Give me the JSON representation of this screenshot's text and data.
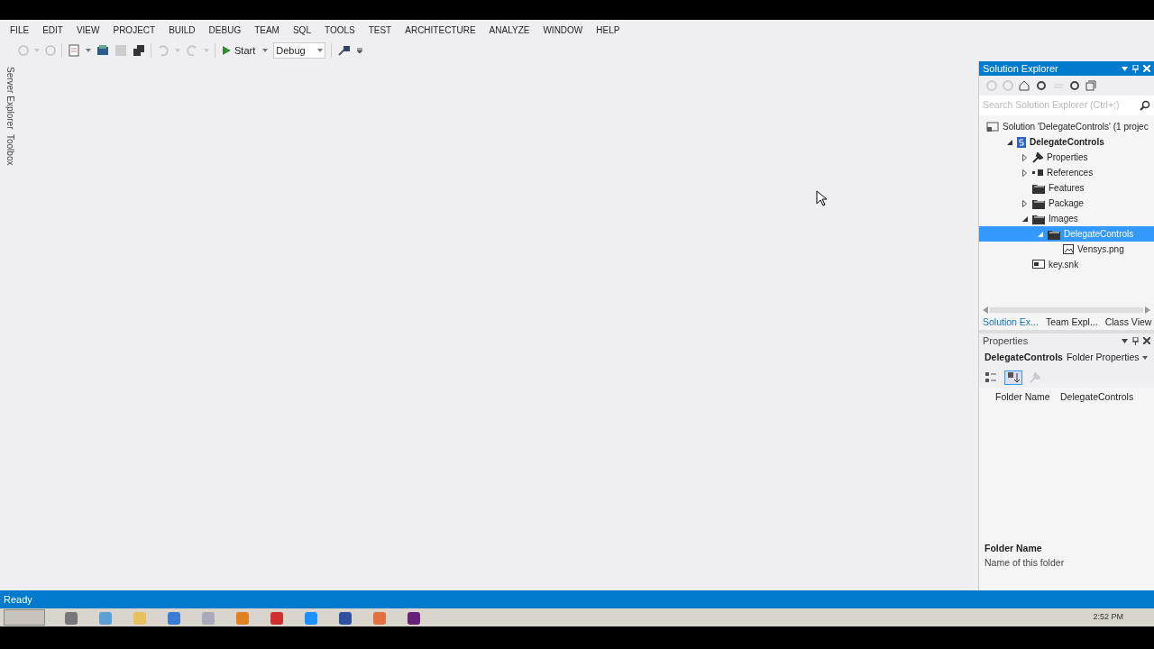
{
  "menu": [
    "FILE",
    "EDIT",
    "VIEW",
    "PROJECT",
    "BUILD",
    "DEBUG",
    "TEAM",
    "SQL",
    "TOOLS",
    "TEST",
    "ARCHITECTURE",
    "ANALYZE",
    "WINDOW",
    "HELP"
  ],
  "toolbar": {
    "start": "Start",
    "configuration": "Debug"
  },
  "side_tabs": [
    "Server Explorer",
    "Toolbox"
  ],
  "solution_explorer": {
    "title": "Solution Explorer",
    "search": {
      "placeholder": "Search Solution Explorer (Ctrl+;)"
    },
    "tree": [
      {
        "label": "Solution 'DelegateControls' (1 projec",
        "kind": "solution",
        "selected": false,
        "children": [
          {
            "label": "DelegateControls",
            "kind": "project",
            "expanded": true,
            "selected": false,
            "children": [
              {
                "label": "Properties",
                "kind": "wrench",
                "expanded": false,
                "selected": false
              },
              {
                "label": "References",
                "kind": "references",
                "expanded": false,
                "selected": false
              },
              {
                "label": "Features",
                "kind": "folder",
                "selected": false
              },
              {
                "label": "Package",
                "kind": "folder",
                "expanded": false,
                "selected": false
              },
              {
                "label": "Images",
                "kind": "folder",
                "expanded": true,
                "selected": false,
                "children": [
                  {
                    "label": "DelegateControls",
                    "kind": "folder",
                    "expanded": true,
                    "selected": true,
                    "children": [
                      {
                        "label": "Vensys.png",
                        "kind": "image",
                        "selected": false
                      }
                    ]
                  }
                ]
              },
              {
                "label": "key.snk",
                "kind": "key",
                "selected": false
              }
            ]
          }
        ]
      }
    ],
    "tabs": [
      {
        "label": "Solution Ex...",
        "selected": true
      },
      {
        "label": "Team Expl...",
        "selected": false
      },
      {
        "label": "Class View",
        "selected": false
      }
    ]
  },
  "properties": {
    "title": "Properties",
    "object_name": "DelegateControls",
    "object_type": "Folder Properties",
    "rows": [
      {
        "name": "Folder Name",
        "value": "DelegateControls"
      }
    ],
    "description_title": "Folder Name",
    "description": "Name of this folder"
  },
  "status_bar": {
    "text": "Ready"
  },
  "taskbar": {
    "clock": "2:52 PM"
  }
}
